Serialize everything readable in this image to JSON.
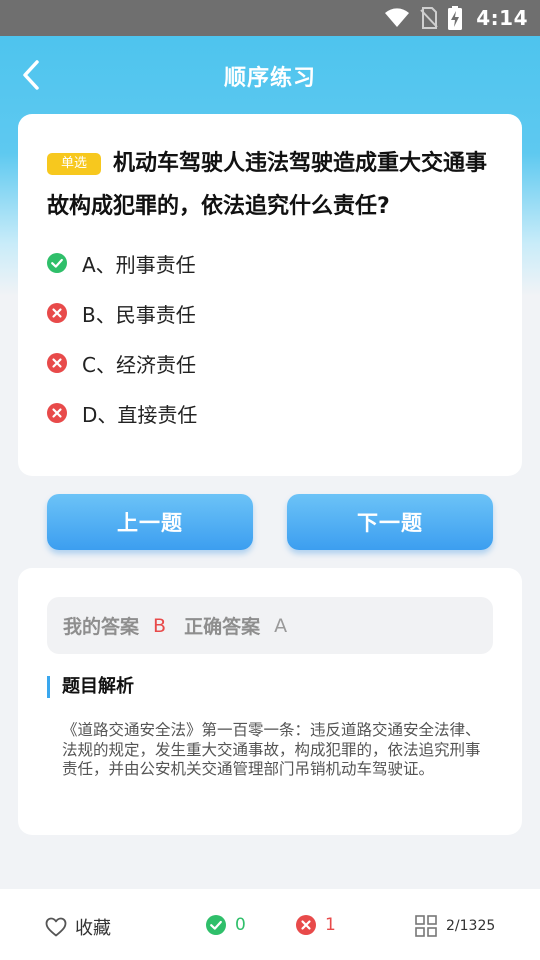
{
  "status_bar": {
    "time": "4:14"
  },
  "header": {
    "title": "顺序练习"
  },
  "question": {
    "type_badge": "单选",
    "text": "机动车驾驶人违法驾驶造成重大交通事故构成犯罪的，依法追究什么责任?",
    "options": [
      {
        "label": "A、刑事责任",
        "state": "correct"
      },
      {
        "label": "B、民事责任",
        "state": "wrong"
      },
      {
        "label": "C、经济责任",
        "state": "wrong"
      },
      {
        "label": "D、直接责任",
        "state": "wrong"
      }
    ]
  },
  "nav": {
    "prev_label": "上一题",
    "next_label": "下一题"
  },
  "analysis": {
    "my_answer_label": "我的答案",
    "my_answer": "B",
    "correct_answer_label": "正确答案",
    "correct_answer": "A",
    "title": "题目解析",
    "text": "《道路交通安全法》第一百零一条：违反道路交通安全法律、法规的规定，发生重大交通事故，构成犯罪的，依法追究刑事责任，并由公安机关交通管理部门吊销机动车驾驶证。"
  },
  "bottom_bar": {
    "favorite_label": "收藏",
    "correct_count": "0",
    "wrong_count": "1",
    "progress": "2/1325"
  },
  "colors": {
    "accent": "#3c9ef0",
    "correct": "#2fbf6a",
    "wrong": "#e84a4a",
    "badge": "#f7c81e"
  },
  "icons": [
    "wifi-icon",
    "no-sim-icon",
    "battery-charging-icon",
    "back-arrow-icon",
    "check-circle-icon",
    "x-circle-icon",
    "heart-icon",
    "grid-icon"
  ]
}
